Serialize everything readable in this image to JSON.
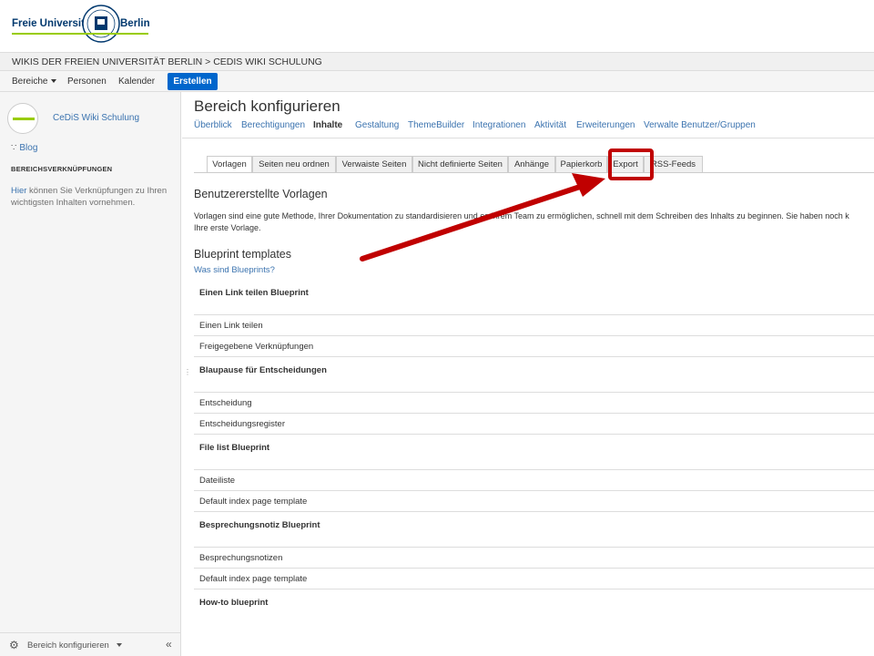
{
  "header": {
    "logo_left": "Freie Universität",
    "logo_right": "Berlin"
  },
  "breadcrumb": "WIKIS DER FREIEN UNIVERSITÄT BERLIN > CEDIS WIKI SCHULUNG",
  "nav": {
    "spaces": "Bereiche",
    "people": "Personen",
    "calendar": "Kalender",
    "create": "Erstellen"
  },
  "sidebar": {
    "space_name": "CeDiS Wiki Schulung",
    "blog": "Blog",
    "section_heading": "BEREICHSVERKNÜPFUNGEN",
    "note_link": "Hier",
    "note_text": " können Sie Verknüpfungen zu Ihren wichtigsten Inhalten vornehmen.",
    "footer_config": "Bereich konfigurieren",
    "collapse": "«"
  },
  "main": {
    "title": "Bereich konfigurieren",
    "top_tabs": [
      "Überblick",
      "Berechtigungen",
      "Inhalte",
      "Gestaltung",
      "ThemeBuilder",
      "Integrationen",
      "Aktivität",
      "Erweiterungen",
      "Verwalte Benutzer/Gruppen"
    ],
    "sub_tabs": [
      "Vorlagen",
      "Seiten neu ordnen",
      "Verwaiste Seiten",
      "Nicht definierte Seiten",
      "Anhänge",
      "Papierkorb",
      "Export",
      "RSS-Feeds"
    ],
    "user_templates_heading": "Benutzererstellte Vorlagen",
    "intro_line1": "Vorlagen sind eine gute Methode, Ihrer Dokumentation zu standardisieren und es Ihrem Team zu ermöglichen, schnell mit dem Schreiben des Inhalts zu beginnen. Sie haben noch k",
    "intro_line2": "Ihre erste Vorlage.",
    "blueprint_heading": "Blueprint templates",
    "what_are_blueprints": "Was sind Blueprints?",
    "templates": [
      {
        "type": "group",
        "label": "Einen Link teilen Blueprint"
      },
      {
        "type": "item",
        "label": "Einen Link teilen"
      },
      {
        "type": "item",
        "label": "Freigegebene Verknüpfungen"
      },
      {
        "type": "group",
        "label": "Blaupause für Entscheidungen"
      },
      {
        "type": "item",
        "label": "Entscheidung"
      },
      {
        "type": "item",
        "label": "Entscheidungsregister"
      },
      {
        "type": "group",
        "label": "File list Blueprint"
      },
      {
        "type": "item",
        "label": "Dateiliste"
      },
      {
        "type": "item",
        "label": "Default index page template"
      },
      {
        "type": "group",
        "label": "Besprechungsnotiz Blueprint"
      },
      {
        "type": "item",
        "label": "Besprechungsnotizen"
      },
      {
        "type": "item",
        "label": "Default index page template"
      },
      {
        "type": "group",
        "label": "How-to blueprint"
      }
    ]
  },
  "annotation": {
    "highlight_color": "#c00000"
  }
}
